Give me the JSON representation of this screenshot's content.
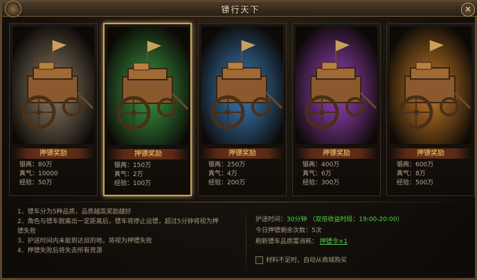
{
  "window": {
    "title": "镖行天下",
    "close_label": "×"
  },
  "cards": [
    {
      "banner": "押镖奖励",
      "silver_label": "银两：",
      "silver": "80万",
      "qi_label": "真气：",
      "qi": "10000",
      "exp_label": "经验：",
      "exp": "50万",
      "glow": "#9a8a72",
      "selected": false
    },
    {
      "banner": "押镖奖励",
      "silver_label": "银两：",
      "silver": "150万",
      "qi_label": "真气：",
      "qi": "2万",
      "exp_label": "经验：",
      "exp": "100万",
      "glow": "#3fae4a",
      "selected": true
    },
    {
      "banner": "押镖奖励",
      "silver_label": "银两：",
      "silver": "250万",
      "qi_label": "真气：",
      "qi": "4万",
      "exp_label": "经验：",
      "exp": "200万",
      "glow": "#3f8fd8",
      "selected": false
    },
    {
      "banner": "押镖奖励",
      "silver_label": "银两：",
      "silver": "400万",
      "qi_label": "真气：",
      "qi": "6万",
      "exp_label": "经验：",
      "exp": "300万",
      "glow": "#b04ad8",
      "selected": false
    },
    {
      "banner": "押镖奖励",
      "silver_label": "银两：",
      "silver": "600万",
      "qi_label": "真气：",
      "qi": "8万",
      "exp_label": "经验：",
      "exp": "500万",
      "glow": "#e08a2a",
      "selected": false
    }
  ],
  "rules": [
    "1、镖车分为5种品质，品质越高奖励越好",
    "2、角色与镖车脱离出一定距离后，镖车将停止运镖，超过5分钟将视为押",
    "镖失败",
    "3、护送时间内未能到达目的地，将视为押镖失败",
    "4、押镖失败后将失去所有资源"
  ],
  "escort": {
    "time_label": "护送时间：",
    "time_value": "30分钟",
    "bonus_text": "（双倍收益时段：19:00-20:00）",
    "remaining_label": "今日押镖剩余次数：",
    "remaining_value": "5次",
    "refresh_label": "刷新镖车品质需消耗：",
    "refresh_item": "押镖令×1",
    "auto_buy_label": "材料不足时，自动从商城购买"
  }
}
